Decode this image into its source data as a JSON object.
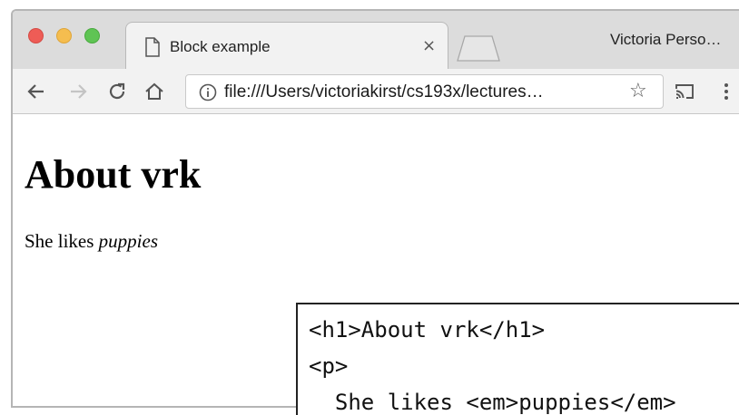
{
  "window": {
    "tab_title": "Block example",
    "tab_close": "×",
    "profile_name": "Victoria Perso…",
    "url": "file:///Users/victoriakirst/cs193x/lectures…"
  },
  "icons": {
    "back": "arrow-left-icon",
    "forward": "arrow-right-icon",
    "reload": "reload-icon",
    "home": "home-icon",
    "info": "info-icon",
    "bookmark": "star-icon",
    "cast": "cast-icon",
    "menu": "kebab-menu-icon",
    "page": "page-icon"
  },
  "colors": {
    "close": "#ee5c56",
    "minimize": "#f5bd4f",
    "maximize": "#5fc454"
  },
  "page": {
    "heading": "About vrk",
    "para_prefix": "She likes ",
    "para_em": "puppies"
  },
  "code": {
    "line1": "<h1>About vrk</h1>",
    "line2": "<p>",
    "line3": "  She likes <em>puppies</em>"
  }
}
